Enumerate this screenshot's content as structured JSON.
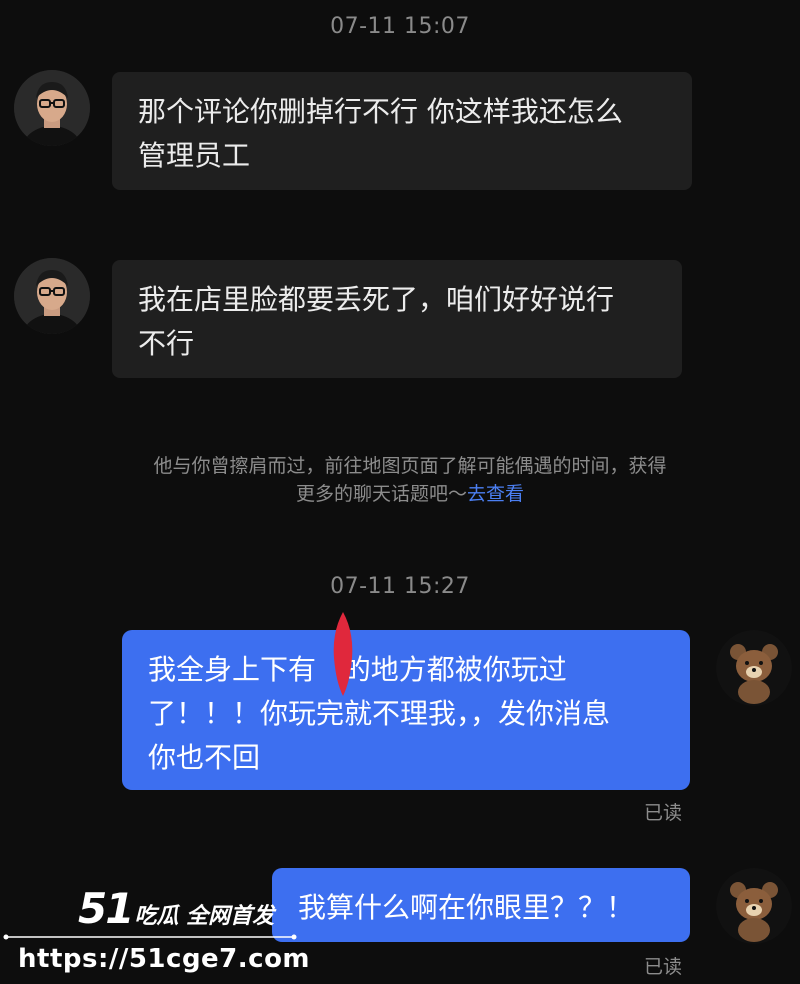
{
  "timestamps": [
    "07-11 15:07",
    "07-11 15:27"
  ],
  "messages_in": [
    {
      "line1": "那个评论你删掉行不行 你这样我还怎么",
      "line2": "管理员工"
    },
    {
      "line1": "我在店里脸都要丢死了，咱们好好说行",
      "line2": "不行"
    }
  ],
  "notice": {
    "line1": "他与你曾擦肩而过，前往地图页面了解可能偶遇的时间，获得",
    "line2_prefix": "更多的聊天话题吧～",
    "link": "去查看"
  },
  "messages_out": [
    {
      "line1": "我全身上下有   的地方都被你玩过",
      "line2": "了！！！你玩完就不理我，，发你消息",
      "line3": "你也不回",
      "status": "已读"
    },
    {
      "line1": "我算什么啊在你眼里？？！",
      "status": "已读"
    }
  ],
  "watermark": {
    "logo_num": "51",
    "logo_text": "吃瓜 全网首发",
    "url": "https://51cge7.com"
  },
  "colors": {
    "background": "#0d0d0d",
    "bubble_in": "#1f1f1f",
    "bubble_out": "#3d6ff0",
    "link": "#4b7ff2",
    "marker": "#e0283c"
  }
}
